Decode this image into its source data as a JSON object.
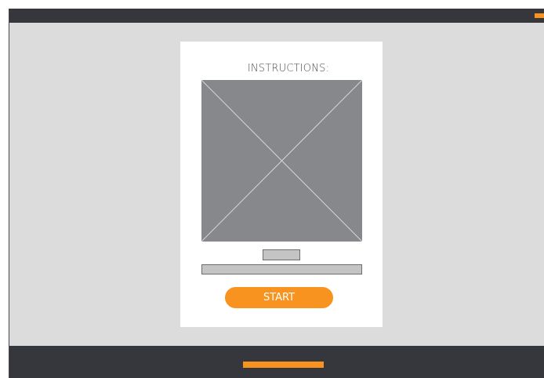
{
  "card": {
    "title": "INSTRUCTIONS:",
    "start_label": "START"
  },
  "colors": {
    "bar_dark": "#35373d",
    "accent": "#f7931e",
    "canvas": "#dcdcdc",
    "image_placeholder": "#87888c",
    "card": "#ffffff"
  },
  "icons": {
    "image_placeholder": "image-placeholder-icon"
  }
}
